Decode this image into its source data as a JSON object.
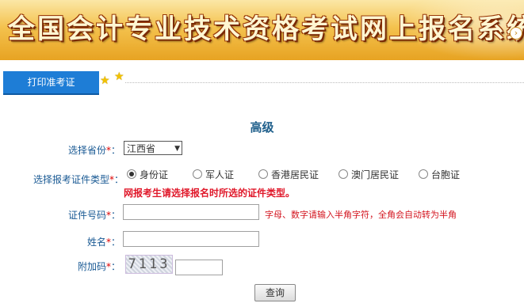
{
  "banner": {
    "title": "全国会计专业技术资格考试网上报名系统"
  },
  "nav": {
    "tab_label": "打印准考证"
  },
  "form": {
    "level": "高级",
    "province_label": "选择省份",
    "province_value": "江西省",
    "id_type_label": "选择报考证件类型",
    "id_types": [
      "身份证",
      "军人证",
      "香港居民证",
      "澳门居民证",
      "台胞证"
    ],
    "id_type_selected": "身份证",
    "id_type_warning": "网报考生请选择报名时所选的证件类型。",
    "id_number_label": "证件号码",
    "id_number_hint": "字母、数字请输入半角字符，全角会自动转为半角",
    "name_label": "姓名",
    "captcha_label": "附加码",
    "captcha_code": "7113",
    "required_mark": "*",
    "colon": "：",
    "submit_label": "查询"
  }
}
